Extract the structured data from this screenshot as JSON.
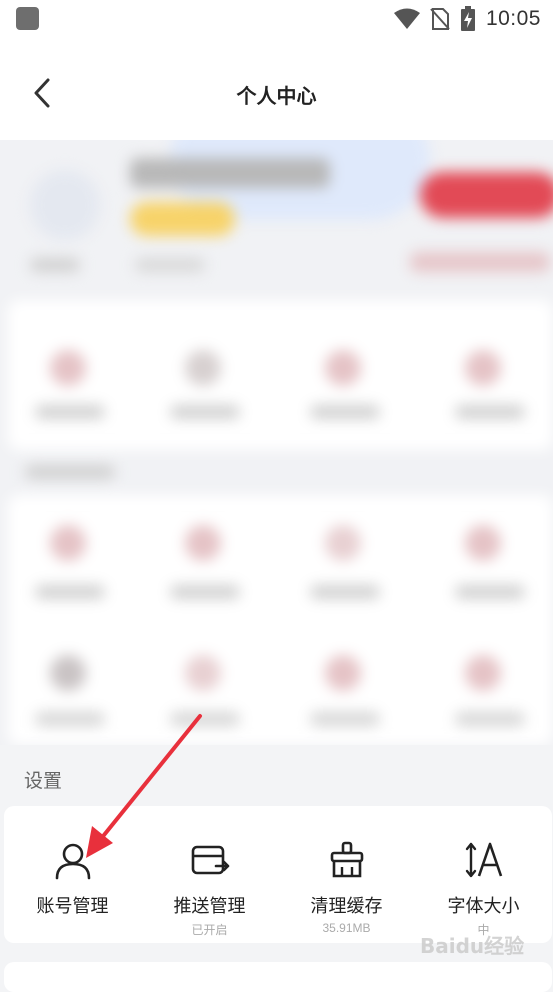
{
  "status_bar": {
    "time": "10:05"
  },
  "header": {
    "title": "个人中心"
  },
  "settings": {
    "section_label": "设置",
    "items": [
      {
        "label": "账号管理",
        "sub": "",
        "icon": "user-icon"
      },
      {
        "label": "推送管理",
        "sub": "已开启",
        "icon": "push-icon"
      },
      {
        "label": "清理缓存",
        "sub": "35.91MB",
        "icon": "broom-icon"
      },
      {
        "label": "字体大小",
        "sub": "中",
        "icon": "font-size-icon"
      }
    ]
  },
  "watermark": {
    "text": "Baidu经验"
  },
  "colors": {
    "accent": "#e8303c",
    "background": "#f3f4f6",
    "card": "#ffffff"
  }
}
